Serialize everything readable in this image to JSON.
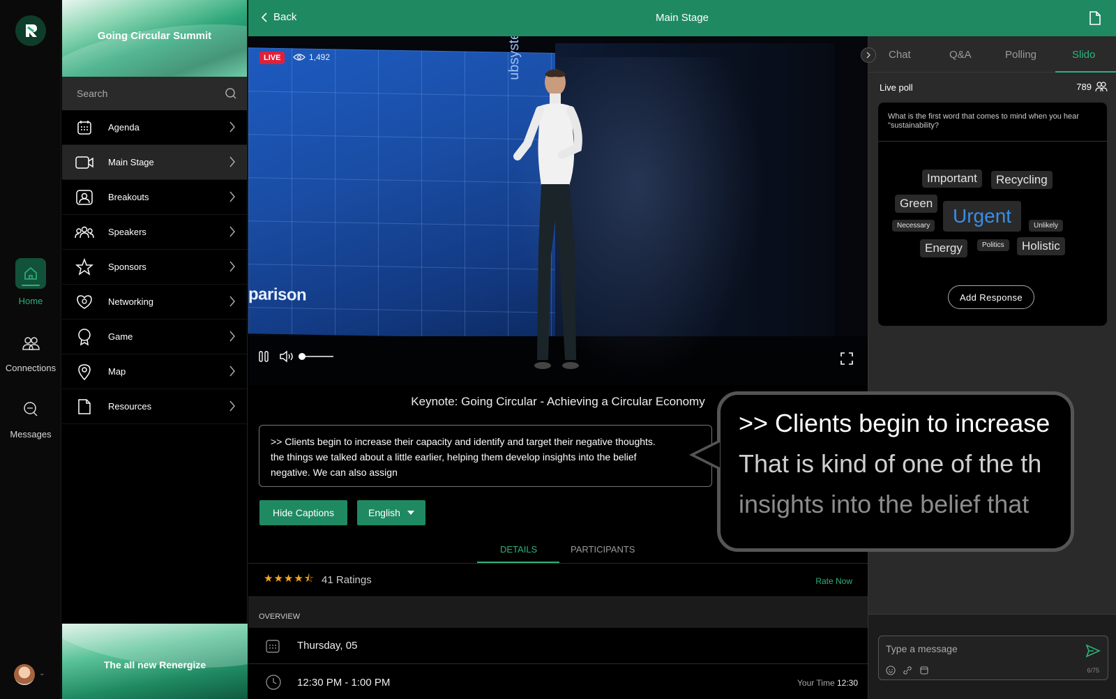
{
  "rail": {
    "items": [
      {
        "label": "Home",
        "icon": "home-icon"
      },
      {
        "label": "Connections",
        "icon": "people-icon"
      },
      {
        "label": "Messages",
        "icon": "chat-icon"
      }
    ]
  },
  "nav": {
    "event_title": "Going Circular Summit",
    "search_placeholder": "Search",
    "items": [
      {
        "label": "Agenda",
        "icon": "calendar-icon"
      },
      {
        "label": "Main Stage",
        "icon": "video-camera-icon"
      },
      {
        "label": "Breakouts",
        "icon": "breakout-icon"
      },
      {
        "label": "Speakers",
        "icon": "group-icon"
      },
      {
        "label": "Sponsors",
        "icon": "star-icon"
      },
      {
        "label": "Networking",
        "icon": "network-icon"
      },
      {
        "label": "Game",
        "icon": "trophy-icon"
      },
      {
        "label": "Map",
        "icon": "map-pin-icon"
      },
      {
        "label": "Resources",
        "icon": "document-icon"
      }
    ],
    "promo": "The all new Renergize"
  },
  "topbar": {
    "back_label": "Back",
    "title": "Main Stage"
  },
  "video": {
    "live_label": "LIVE",
    "viewers": "1,492",
    "slide_text": "parison",
    "slide_vertical_text": "ubsystem"
  },
  "session": {
    "title": "Keynote: Going Circular - Achieving a Circular Economy",
    "captions": [
      ">> Clients begin to increase their capacity and identify and target their negative thoughts.",
      "the things we talked about a little earlier, helping them develop insights into the belief",
      "negative. We can also assign"
    ],
    "hide_captions_label": "Hide Captions",
    "language": "English",
    "tabs": [
      "DETAILS",
      "PARTICIPANTS"
    ],
    "ratings_text": "41 Ratings",
    "rating_value": 4.5,
    "rate_now": "Rate Now",
    "overview_label": "OVERVIEW",
    "date": "Thursday, 05",
    "time": "12:30 PM - 1:00 PM",
    "your_time_label": "Your Time",
    "your_time_value": "12:30"
  },
  "right_panel": {
    "tabs": [
      "Chat",
      "Q&A",
      "Polling",
      "Slido"
    ],
    "poll_title": "Live poll",
    "poll_count": "789",
    "question": "What is the first word that comes to mind when you hear \"sustainability?",
    "words": [
      "Important",
      "Recycling",
      "Green",
      "Urgent",
      "Necessary",
      "Unlikely",
      "Energy",
      "Politics",
      "Holistic"
    ],
    "add_response": "Add Response",
    "message_placeholder": "Type a message",
    "char_count": "6/75"
  },
  "zoom_bubble": {
    "lines": [
      ">> Clients begin to increase",
      "That is kind of one of the th",
      "insights into the belief that"
    ]
  },
  "colors": {
    "accent": "#1f8a62",
    "accent_text": "#2db27d",
    "live": "#e0203a",
    "star": "#f5a623",
    "urgent": "#3a8ee6"
  }
}
